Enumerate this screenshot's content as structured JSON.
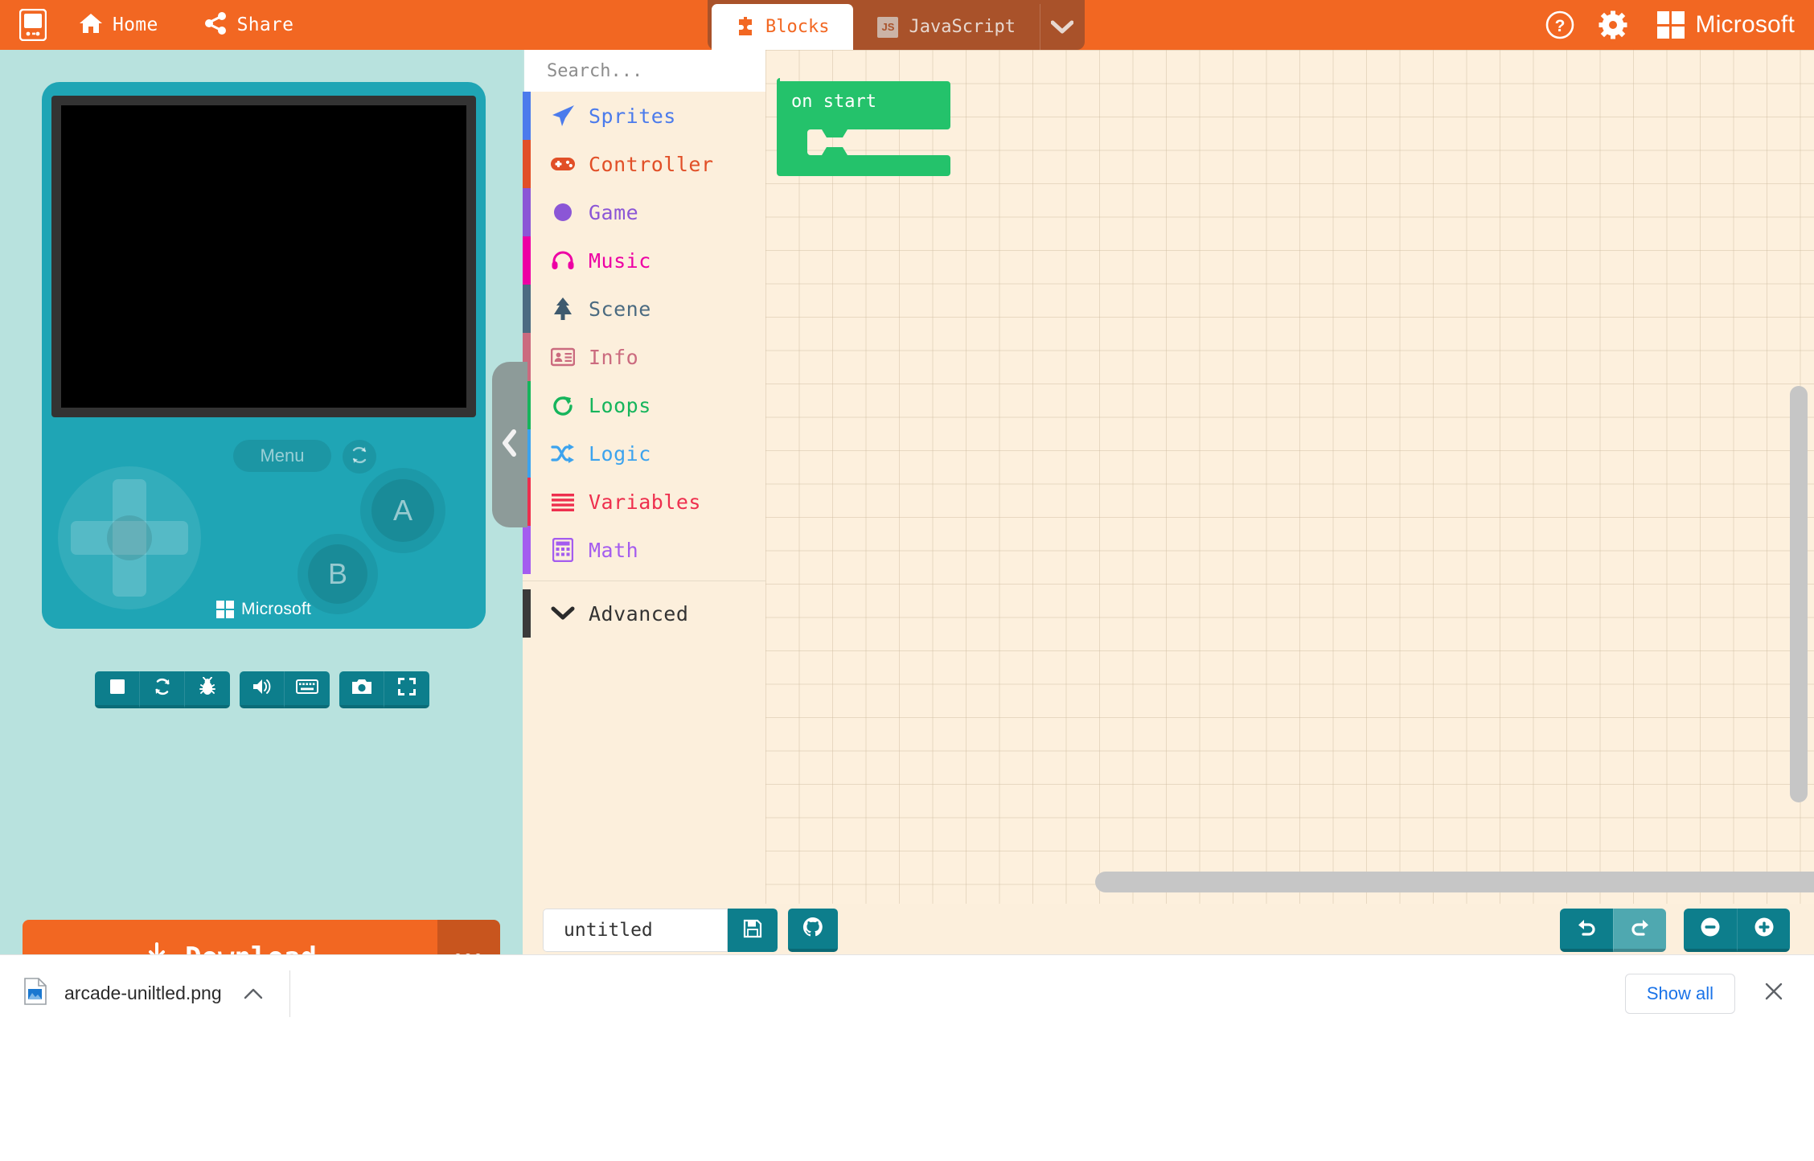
{
  "header": {
    "logo_icon": "arcade-logo-icon",
    "items": [
      {
        "label": "Home",
        "icon": "home-icon"
      },
      {
        "label": "Share",
        "icon": "share-icon"
      }
    ],
    "tabs": [
      {
        "label": "Blocks",
        "icon": "puzzle-icon",
        "active": true
      },
      {
        "label": "JavaScript",
        "icon": "js-badge-icon",
        "active": false
      }
    ],
    "tab_caret_icon": "chevron-down-icon",
    "help_icon": "help-circle-icon",
    "settings_icon": "gear-icon",
    "brand": "Microsoft",
    "bg_color": "#F26722",
    "tab_bar_color": "#A9522A"
  },
  "simulator": {
    "menu_label": "Menu",
    "reset_icon": "refresh-icon",
    "button_a": "A",
    "button_b": "B",
    "brand": "Microsoft",
    "device_color": "#1FA5B5",
    "panel_color": "#b8e2de",
    "screen_color": "#000000",
    "toolbar_groups": [
      [
        {
          "icon": "stop-icon",
          "name": "stop-button"
        },
        {
          "icon": "restart-icon",
          "name": "restart-button"
        },
        {
          "icon": "debug-bug-icon",
          "name": "debug-button"
        }
      ],
      [
        {
          "icon": "speaker-icon",
          "name": "mute-button"
        },
        {
          "icon": "keyboard-icon",
          "name": "keyboard-button"
        }
      ],
      [
        {
          "icon": "camera-icon",
          "name": "screenshot-button"
        },
        {
          "icon": "fullscreen-icon",
          "name": "fullscreen-button"
        }
      ]
    ],
    "download_label": "Download",
    "download_icon": "download-icon",
    "download_more": "•••",
    "download_color": "#F26722"
  },
  "toolbox": {
    "search_placeholder": "Search...",
    "search_value": "",
    "search_icon": "search-icon",
    "categories": [
      {
        "label": "Sprites",
        "icon": "paper-plane-icon",
        "color": "#4B7BEC"
      },
      {
        "label": "Controller",
        "icon": "gamepad-icon",
        "color": "#E14F27"
      },
      {
        "label": "Game",
        "icon": "circle-icon",
        "color": "#8B56D6"
      },
      {
        "label": "Music",
        "icon": "headphones-icon",
        "color": "#ED00A4"
      },
      {
        "label": "Scene",
        "icon": "tree-icon",
        "color": "#4B6B81"
      },
      {
        "label": "Info",
        "icon": "id-card-icon",
        "color": "#CB6B7F"
      },
      {
        "label": "Loops",
        "icon": "loop-arrow-icon",
        "color": "#16B55C"
      },
      {
        "label": "Logic",
        "icon": "shuffle-icon",
        "color": "#3CA3EE"
      },
      {
        "label": "Variables",
        "icon": "list-lines-icon",
        "color": "#EE2F4E"
      },
      {
        "label": "Math",
        "icon": "calculator-icon",
        "color": "#A45CEF"
      }
    ],
    "advanced": {
      "label": "Advanced",
      "icon": "chevron-down-icon",
      "color": "#3A3A3A"
    },
    "collapse_icon": "chevron-left-icon",
    "bg_color": "#FCEFDC"
  },
  "workspace": {
    "bg_color": "#FDF0DD",
    "blocks": [
      {
        "label": "on start",
        "color": "#24C26B",
        "name": "block-on-start"
      }
    ]
  },
  "editor_bar": {
    "project_name_value": "untitled",
    "project_name_placeholder": "untitled",
    "save_icon": "floppy-save-icon",
    "github_icon": "github-icon",
    "undo_icon": "undo-icon",
    "redo_icon": "redo-icon",
    "zoom_out_icon": "minus-circle-icon",
    "zoom_in_icon": "plus-circle-icon"
  },
  "download_shelf": {
    "file_name": "arcade-uniltled.png",
    "file_icon": "image-file-icon",
    "expand_icon": "chevron-up-icon",
    "show_all_label": "Show all",
    "close_icon": "close-icon",
    "link_color": "#1a73e8"
  }
}
